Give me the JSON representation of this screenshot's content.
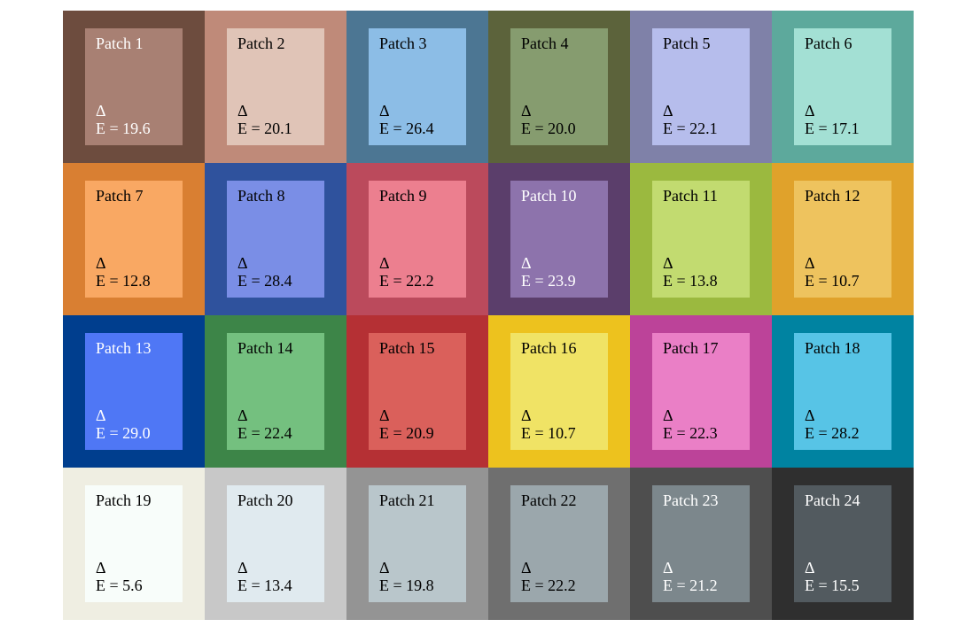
{
  "chart_data": {
    "type": "table",
    "title": "",
    "rows": 4,
    "cols": 6,
    "patches": [
      {
        "id": 1,
        "label": "Patch 1",
        "deltaE": 19.6,
        "outer": "#6d4c3e",
        "inner": "#a88073",
        "text": "white"
      },
      {
        "id": 2,
        "label": "Patch 2",
        "deltaE": 20.1,
        "outer": "#bf8a79",
        "inner": "#e0c4b7",
        "text": "black"
      },
      {
        "id": 3,
        "label": "Patch 3",
        "deltaE": 26.4,
        "outer": "#4c7693",
        "inner": "#8cbde6",
        "text": "black"
      },
      {
        "id": 4,
        "label": "Patch 4",
        "deltaE": 20.0,
        "outer": "#5c633b",
        "inner": "#869c6f",
        "text": "black"
      },
      {
        "id": 5,
        "label": "Patch 5",
        "deltaE": 22.1,
        "outer": "#7f81a8",
        "inner": "#b6bdec",
        "text": "black"
      },
      {
        "id": 6,
        "label": "Patch 6",
        "deltaE": 17.1,
        "outer": "#5da99c",
        "inner": "#a3e0d4",
        "text": "black"
      },
      {
        "id": 7,
        "label": "Patch 7",
        "deltaE": 12.8,
        "outer": "#d97f32",
        "inner": "#f9a863",
        "text": "black"
      },
      {
        "id": 8,
        "label": "Patch 8",
        "deltaE": 28.4,
        "outer": "#2f529d",
        "inner": "#7a8ee6",
        "text": "black"
      },
      {
        "id": 9,
        "label": "Patch 9",
        "deltaE": 22.2,
        "outer": "#bb4a5c",
        "inner": "#ec7f8f",
        "text": "black"
      },
      {
        "id": 10,
        "label": "Patch 10",
        "deltaE": 23.9,
        "outer": "#5b3e6b",
        "inner": "#8d73ac",
        "text": "white"
      },
      {
        "id": 11,
        "label": "Patch 11",
        "deltaE": 13.8,
        "outer": "#9bb93f",
        "inner": "#c2db70",
        "text": "black"
      },
      {
        "id": 12,
        "label": "Patch 12",
        "deltaE": 10.7,
        "outer": "#e0a22b",
        "inner": "#eec35e",
        "text": "black"
      },
      {
        "id": 13,
        "label": "Patch 13",
        "deltaE": 29.0,
        "outer": "#003e8e",
        "inner": "#4f77f5",
        "text": "white"
      },
      {
        "id": 14,
        "label": "Patch 14",
        "deltaE": 22.4,
        "outer": "#3d8548",
        "inner": "#74c07f",
        "text": "black"
      },
      {
        "id": 15,
        "label": "Patch 15",
        "deltaE": 20.9,
        "outer": "#b53034",
        "inner": "#da605b",
        "text": "black"
      },
      {
        "id": 16,
        "label": "Patch 16",
        "deltaE": 10.7,
        "outer": "#edc21e",
        "inner": "#f0e365",
        "text": "black"
      },
      {
        "id": 17,
        "label": "Patch 17",
        "deltaE": 22.3,
        "outer": "#bc4399",
        "inner": "#ea7fc6",
        "text": "black"
      },
      {
        "id": 18,
        "label": "Patch 18",
        "deltaE": 28.2,
        "outer": "#0083a1",
        "inner": "#57c4e6",
        "text": "black"
      },
      {
        "id": 19,
        "label": "Patch 19",
        "deltaE": 5.6,
        "outer": "#efeee2",
        "inner": "#f8fdfa",
        "text": "black"
      },
      {
        "id": 20,
        "label": "Patch 20",
        "deltaE": 13.4,
        "outer": "#c8c8c8",
        "inner": "#e0eaef",
        "text": "black"
      },
      {
        "id": 21,
        "label": "Patch 21",
        "deltaE": 19.8,
        "outer": "#949494",
        "inner": "#b9c6cb",
        "text": "black"
      },
      {
        "id": 22,
        "label": "Patch 22",
        "deltaE": 22.2,
        "outer": "#6f6f6f",
        "inner": "#9ba7ac",
        "text": "black"
      },
      {
        "id": 23,
        "label": "Patch 23",
        "deltaE": 21.2,
        "outer": "#4e4e4e",
        "inner": "#7c878c",
        "text": "white"
      },
      {
        "id": 24,
        "label": "Patch 24",
        "deltaE": 15.5,
        "outer": "#2f2f2f",
        "inner": "#525a5f",
        "text": "white"
      }
    ]
  },
  "strings": {
    "delta_prefix": "Δ",
    "e_prefix": "E = "
  }
}
